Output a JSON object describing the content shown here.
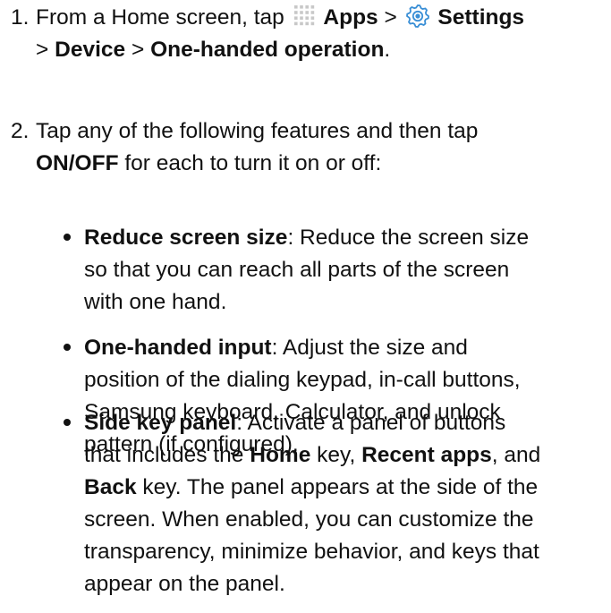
{
  "step1": {
    "number": "1.",
    "text_from": "From a Home screen, tap",
    "apps_label": "Apps",
    "sep1": ">",
    "settings_label": "Settings",
    "sep2": ">",
    "device_label": "Device",
    "sep3": ">",
    "one_handed_label": "One-handed operation",
    "period": ".",
    "apps_icon": "apps-grid-icon",
    "settings_icon": "settings-gear-icon"
  },
  "step2": {
    "number": "2.",
    "line1": "Tap any of the following features and then tap",
    "on_off": "ON/OFF",
    "line2_rest": "for each to turn it on or off:"
  },
  "bullets": {
    "reduce": {
      "title": "Reduce screen size",
      "l1": ": Reduce the screen size",
      "l2": "so that you can reach all parts of the screen",
      "l3": "with one hand."
    },
    "input": {
      "title": "One-handed input",
      "l1": ": Adjust the size and",
      "l2": "position of the dialing keypad, in-call buttons,",
      "l3": "Samsung keyboard, Calculator, and unlock",
      "l4": "pattern (if configured)."
    },
    "side": {
      "title": "Side key panel",
      "l1": ": Activate a panel of buttons",
      "l2a": "that includes the",
      "home": "Home",
      "l2b": "key,",
      "recent": "Recent apps",
      "l2c": ", and",
      "back": "Back",
      "l3": "key. The panel appears at the side of the",
      "l4": "screen. When enabled, you can customize the",
      "l5": "transparency, minimize behavior, and keys that",
      "l6": "appear on the panel."
    }
  },
  "colors": {
    "text": "#111111",
    "apps_icon": "#c8c8c8",
    "settings_icon": "#3a8fd6"
  }
}
